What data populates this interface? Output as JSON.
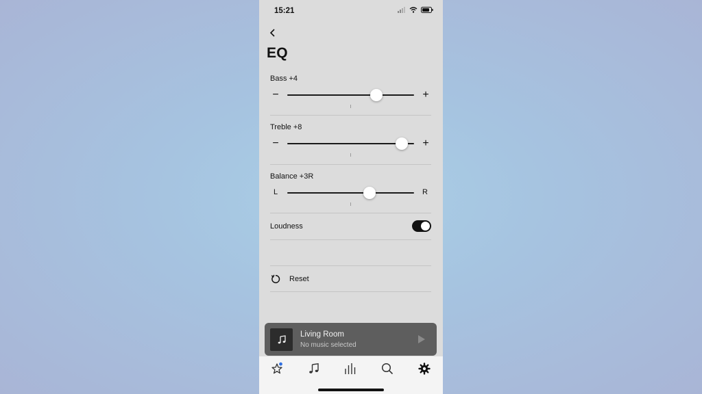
{
  "status_bar": {
    "time": "15:21"
  },
  "page": {
    "title": "EQ"
  },
  "sliders": [
    {
      "id": "bass",
      "label": "Bass +4",
      "value": 4,
      "min": -10,
      "max": 10,
      "left_label": "−",
      "right_label": "+"
    },
    {
      "id": "treble",
      "label": "Treble +8",
      "value": 8,
      "min": -10,
      "max": 10,
      "left_label": "−",
      "right_label": "+"
    },
    {
      "id": "balance",
      "label": "Balance +3R",
      "value": 3,
      "min": -10,
      "max": 10,
      "left_label": "L",
      "right_label": "R"
    }
  ],
  "loudness": {
    "label": "Loudness",
    "enabled": true
  },
  "reset": {
    "label": "Reset"
  },
  "mini_player": {
    "room": "Living Room",
    "status": "No music selected"
  },
  "tab_bar": {
    "items": [
      "favorites-icon",
      "music-icon",
      "rooms-icon",
      "search-icon",
      "settings-icon"
    ],
    "active": "settings-icon",
    "badge_color": "#2f6fe0"
  },
  "colors": {
    "background": "#dcdcdc",
    "mini_player": "#5e5e5e",
    "accent_badge": "#2f6fe0"
  }
}
